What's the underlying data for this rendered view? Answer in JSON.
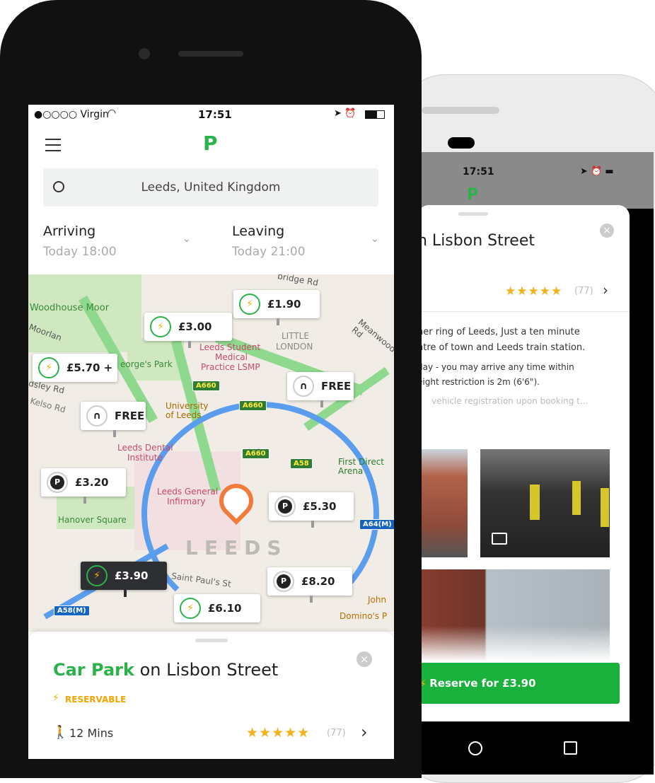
{
  "back": {
    "status_time": "17:51",
    "card_title": "n Lisbon Street",
    "rating_count": "(77)",
    "desc_line1": "ner ring of Leeds, Just a ten minute",
    "desc_line2": "ntre of town and Leeds train station.",
    "desc_line3": "day - you may arrive any time within",
    "desc_line4": "eight restriction is 2m (6'6\").",
    "desc_line5": "vehicle registration upon booking t...",
    "reserve_label": "Reserve for £3.90"
  },
  "front": {
    "carrier": "●○○○○ Virgin",
    "time": "17:51",
    "search_value": "Leeds, United Kingdom",
    "arriving_label": "Arriving",
    "arriving_value": "Today 18:00",
    "leaving_label": "Leaving",
    "leaving_value": "Today 21:00",
    "map_labels": {
      "woodhouse": "Woodhouse Moor",
      "moorland": "Moorlan",
      "georges": "eorge's Park",
      "leeds_student": "Leeds Student",
      "medical": "Medical",
      "practice": "Practice LSMP",
      "little": "LITTLE",
      "london": "LONDON",
      "university": "University",
      "of_leeds": "of Leeds",
      "dental": "Leeds Dental",
      "institute": "Institute",
      "general": "Leeds General",
      "infirmary": "Infirmary",
      "hanover": "Hanover Square",
      "leeds_big": "LEEDS",
      "first_direct": "First Direct",
      "arena": "Arena",
      "st_pauls": "Saint Paul's St",
      "john": "John",
      "dominos": "Domino's P",
      "bridge_rd": "bridge Rd",
      "meanwood": "Meanwood Rd",
      "dsley": "dsley Rd",
      "kelso": "Kelso Rd"
    },
    "pins": {
      "p190": "£1.90",
      "p300": "£3.00",
      "p570": "£5.70 +",
      "free1": "FREE",
      "free2": "FREE",
      "p320": "£3.20",
      "p530": "£5.30",
      "p390": "£3.90",
      "p820": "£8.20",
      "p610": "£6.10"
    },
    "shields": {
      "a660a": "A660",
      "a660b": "A660",
      "a660c": "A660",
      "a58": "A58",
      "a64m": "A64(M)",
      "a58m": "A58(M)"
    },
    "card": {
      "title_green": "Car Park",
      "title_rest": " on Lisbon Street",
      "reservable": "RESERVABLE",
      "walk": "12 Mins",
      "rating_count": "(77)"
    }
  },
  "colors": {
    "accent": "#2bb34a",
    "star": "#f3b21b",
    "reserve_bg": "#19b13c"
  }
}
